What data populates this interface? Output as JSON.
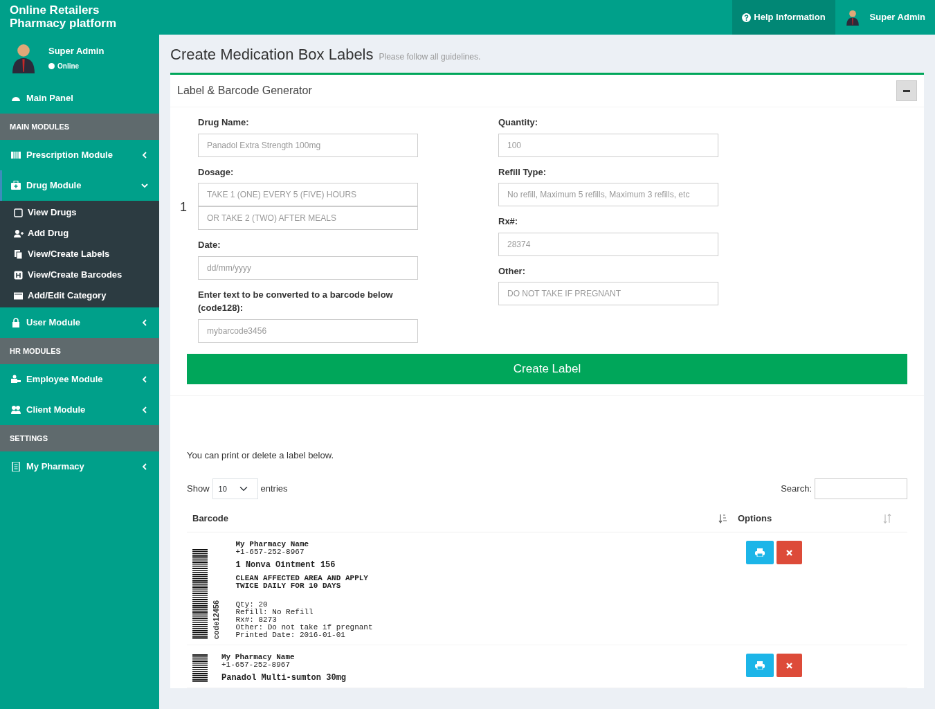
{
  "header": {
    "brand_lines": [
      "Online Retailers",
      "Pharmacy platform"
    ],
    "help": "Help Information",
    "user": "Super Admin"
  },
  "sidebar": {
    "user": {
      "name": "Super Admin",
      "status": "Online"
    },
    "items": [
      {
        "kind": "link",
        "label": "Main Panel"
      },
      {
        "kind": "header",
        "label": "MAIN MODULES"
      },
      {
        "kind": "module",
        "label": "Prescription Module",
        "expanded": false
      },
      {
        "kind": "module",
        "label": "Drug Module",
        "expanded": true,
        "children": [
          {
            "label": "View Drugs"
          },
          {
            "label": "Add Drug"
          },
          {
            "label": "View/Create Labels"
          },
          {
            "label": "View/Create Barcodes"
          },
          {
            "label": "Add/Edit Category"
          }
        ]
      },
      {
        "kind": "module",
        "label": "User Module",
        "expanded": false
      },
      {
        "kind": "header",
        "label": "HR MODULES"
      },
      {
        "kind": "module",
        "label": "Employee Module",
        "expanded": false
      },
      {
        "kind": "module",
        "label": "Client Module",
        "expanded": false
      },
      {
        "kind": "header",
        "label": "SETTINGS"
      },
      {
        "kind": "module",
        "label": "My Pharmacy",
        "expanded": false
      }
    ]
  },
  "page": {
    "title": "Create Medication Box Labels",
    "subtitle": "Please follow all guidelines."
  },
  "box": {
    "title": "Label & Barcode Generator",
    "left_fields": [
      {
        "label": "Drug Name:",
        "placeholders": [
          "Panadol Extra Strength 100mg"
        ]
      },
      {
        "label": "Dosage:",
        "marker": "1",
        "placeholders": [
          "TAKE 1 (ONE) EVERY 5 (FIVE) HOURS",
          "OR TAKE 2 (TWO) AFTER MEALS"
        ]
      },
      {
        "label": "Date:",
        "placeholders": [
          "dd/mm/yyyy"
        ]
      },
      {
        "label": "Enter text to be converted to a barcode below (code128):",
        "placeholders": [
          "mybarcode3456"
        ]
      }
    ],
    "right_fields": [
      {
        "label": "Quantity:",
        "placeholders": [
          "100"
        ]
      },
      {
        "label": "Refill Type:",
        "placeholders": [
          "No refill, Maximum 5 refills, Maximum 3 refills, etc"
        ]
      },
      {
        "label": "Rx#:",
        "placeholders": [
          "28374"
        ]
      },
      {
        "label": "Other:",
        "placeholders": [
          "DO NOT TAKE IF PREGNANT"
        ]
      }
    ],
    "submit": "Create Label"
  },
  "labels_table": {
    "intro": "You can print or delete a label below.",
    "show": "Show",
    "page_size": "10",
    "entries": "entries",
    "search": "Search:",
    "columns": [
      "Barcode",
      "Options"
    ],
    "rows": [
      {
        "barcode_text": "code12456",
        "pharmacy": "My Pharmacy Name",
        "phone": "+1-657-252-8967",
        "drug": "1 Nonva Ointment 156",
        "instructions": [
          "CLEAN AFFECTED AREA AND APPLY",
          "TWICE DAILY FOR 10 DAYS"
        ],
        "details": [
          "Qty: 20",
          "Refill: No Refill",
          "Rx#: 8273",
          "Other: Do not take if pregnant",
          "Printed Date: 2016-01-01"
        ]
      },
      {
        "pharmacy": "My Pharmacy Name",
        "phone": "+1-657-252-8967",
        "drug": "Panadol Multi-sumton 30mg",
        "instructions": [],
        "details": []
      }
    ]
  }
}
